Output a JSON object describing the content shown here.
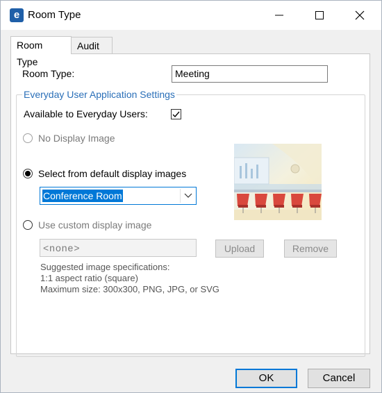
{
  "window": {
    "title": "Room Type",
    "app_icon_glyph": "e",
    "accent": "#0078d7"
  },
  "tabs": [
    {
      "label": "Room Type"
    },
    {
      "label": "Audit"
    }
  ],
  "form": {
    "room_type_label": "Room Type:",
    "room_type_value": "Meeting",
    "group_title": "Everyday User Application Settings",
    "available_label": "Available to Everyday Users:",
    "available_checked": true,
    "no_display_label": "No Display Image",
    "select_default_label": "Select from default display images",
    "default_image_selected": "Conference Room",
    "custom_label": "Use custom display image",
    "custom_path": "<none>",
    "upload_label": "Upload",
    "remove_label": "Remove",
    "spec_line1": "Suggested image specifications:",
    "spec_line2": "1:1 aspect ratio (square)",
    "spec_line3": "Maximum size: 300x300, PNG, JPG, or SVG"
  },
  "footer": {
    "ok_label": "OK",
    "cancel_label": "Cancel"
  }
}
